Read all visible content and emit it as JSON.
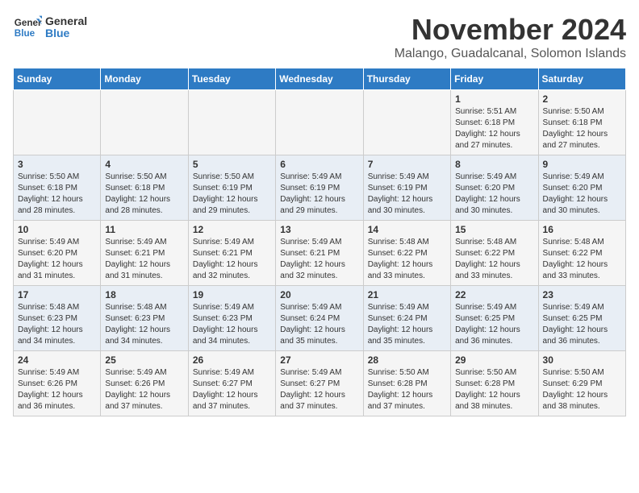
{
  "logo": {
    "line1": "General",
    "line2": "Blue"
  },
  "title": "November 2024",
  "location": "Malango, Guadalcanal, Solomon Islands",
  "days_of_week": [
    "Sunday",
    "Monday",
    "Tuesday",
    "Wednesday",
    "Thursday",
    "Friday",
    "Saturday"
  ],
  "weeks": [
    [
      {
        "day": "",
        "info": ""
      },
      {
        "day": "",
        "info": ""
      },
      {
        "day": "",
        "info": ""
      },
      {
        "day": "",
        "info": ""
      },
      {
        "day": "",
        "info": ""
      },
      {
        "day": "1",
        "info": "Sunrise: 5:51 AM\nSunset: 6:18 PM\nDaylight: 12 hours\nand 27 minutes."
      },
      {
        "day": "2",
        "info": "Sunrise: 5:50 AM\nSunset: 6:18 PM\nDaylight: 12 hours\nand 27 minutes."
      }
    ],
    [
      {
        "day": "3",
        "info": "Sunrise: 5:50 AM\nSunset: 6:18 PM\nDaylight: 12 hours\nand 28 minutes."
      },
      {
        "day": "4",
        "info": "Sunrise: 5:50 AM\nSunset: 6:18 PM\nDaylight: 12 hours\nand 28 minutes."
      },
      {
        "day": "5",
        "info": "Sunrise: 5:50 AM\nSunset: 6:19 PM\nDaylight: 12 hours\nand 29 minutes."
      },
      {
        "day": "6",
        "info": "Sunrise: 5:49 AM\nSunset: 6:19 PM\nDaylight: 12 hours\nand 29 minutes."
      },
      {
        "day": "7",
        "info": "Sunrise: 5:49 AM\nSunset: 6:19 PM\nDaylight: 12 hours\nand 30 minutes."
      },
      {
        "day": "8",
        "info": "Sunrise: 5:49 AM\nSunset: 6:20 PM\nDaylight: 12 hours\nand 30 minutes."
      },
      {
        "day": "9",
        "info": "Sunrise: 5:49 AM\nSunset: 6:20 PM\nDaylight: 12 hours\nand 30 minutes."
      }
    ],
    [
      {
        "day": "10",
        "info": "Sunrise: 5:49 AM\nSunset: 6:20 PM\nDaylight: 12 hours\nand 31 minutes."
      },
      {
        "day": "11",
        "info": "Sunrise: 5:49 AM\nSunset: 6:21 PM\nDaylight: 12 hours\nand 31 minutes."
      },
      {
        "day": "12",
        "info": "Sunrise: 5:49 AM\nSunset: 6:21 PM\nDaylight: 12 hours\nand 32 minutes."
      },
      {
        "day": "13",
        "info": "Sunrise: 5:49 AM\nSunset: 6:21 PM\nDaylight: 12 hours\nand 32 minutes."
      },
      {
        "day": "14",
        "info": "Sunrise: 5:48 AM\nSunset: 6:22 PM\nDaylight: 12 hours\nand 33 minutes."
      },
      {
        "day": "15",
        "info": "Sunrise: 5:48 AM\nSunset: 6:22 PM\nDaylight: 12 hours\nand 33 minutes."
      },
      {
        "day": "16",
        "info": "Sunrise: 5:48 AM\nSunset: 6:22 PM\nDaylight: 12 hours\nand 33 minutes."
      }
    ],
    [
      {
        "day": "17",
        "info": "Sunrise: 5:48 AM\nSunset: 6:23 PM\nDaylight: 12 hours\nand 34 minutes."
      },
      {
        "day": "18",
        "info": "Sunrise: 5:48 AM\nSunset: 6:23 PM\nDaylight: 12 hours\nand 34 minutes."
      },
      {
        "day": "19",
        "info": "Sunrise: 5:49 AM\nSunset: 6:23 PM\nDaylight: 12 hours\nand 34 minutes."
      },
      {
        "day": "20",
        "info": "Sunrise: 5:49 AM\nSunset: 6:24 PM\nDaylight: 12 hours\nand 35 minutes."
      },
      {
        "day": "21",
        "info": "Sunrise: 5:49 AM\nSunset: 6:24 PM\nDaylight: 12 hours\nand 35 minutes."
      },
      {
        "day": "22",
        "info": "Sunrise: 5:49 AM\nSunset: 6:25 PM\nDaylight: 12 hours\nand 36 minutes."
      },
      {
        "day": "23",
        "info": "Sunrise: 5:49 AM\nSunset: 6:25 PM\nDaylight: 12 hours\nand 36 minutes."
      }
    ],
    [
      {
        "day": "24",
        "info": "Sunrise: 5:49 AM\nSunset: 6:26 PM\nDaylight: 12 hours\nand 36 minutes."
      },
      {
        "day": "25",
        "info": "Sunrise: 5:49 AM\nSunset: 6:26 PM\nDaylight: 12 hours\nand 37 minutes."
      },
      {
        "day": "26",
        "info": "Sunrise: 5:49 AM\nSunset: 6:27 PM\nDaylight: 12 hours\nand 37 minutes."
      },
      {
        "day": "27",
        "info": "Sunrise: 5:49 AM\nSunset: 6:27 PM\nDaylight: 12 hours\nand 37 minutes."
      },
      {
        "day": "28",
        "info": "Sunrise: 5:50 AM\nSunset: 6:28 PM\nDaylight: 12 hours\nand 37 minutes."
      },
      {
        "day": "29",
        "info": "Sunrise: 5:50 AM\nSunset: 6:28 PM\nDaylight: 12 hours\nand 38 minutes."
      },
      {
        "day": "30",
        "info": "Sunrise: 5:50 AM\nSunset: 6:29 PM\nDaylight: 12 hours\nand 38 minutes."
      }
    ]
  ]
}
